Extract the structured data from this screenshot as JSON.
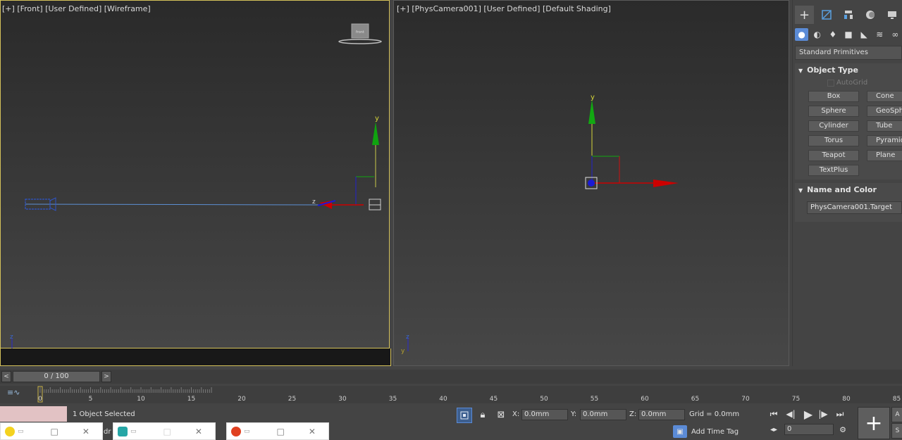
{
  "viewports": {
    "left": {
      "label_plus": "[+]",
      "label_view": "[Front]",
      "label_custom": "[User Defined]",
      "label_shading": "[Wireframe]"
    },
    "right": {
      "label_plus": "[+]",
      "label_view": "[PhysCamera001]",
      "label_custom": "[User Defined]",
      "label_shading": "[Default Shading]"
    },
    "viewcube_label": "front",
    "axis_y": "y",
    "axis_z": "z",
    "axis_x": "x"
  },
  "command_panel": {
    "tabs": [
      "+",
      "modify",
      "hierarchy",
      "motion",
      "display",
      "utilities"
    ],
    "categories": [
      "geometry",
      "shapes",
      "lights",
      "cameras",
      "helpers",
      "spacewarps",
      "systems"
    ],
    "dropdown": "Standard Primitives",
    "object_type": {
      "title": "Object Type",
      "autogrid": "AutoGrid",
      "buttons": [
        "Box",
        "Cone",
        "Sphere",
        "GeoSphere",
        "Cylinder",
        "Tube",
        "Torus",
        "Pyramid",
        "Teapot",
        "Plane",
        "TextPlus"
      ]
    },
    "name_color": {
      "title": "Name and Color",
      "name_value": "PhysCamera001.Target"
    }
  },
  "time_slider": {
    "value": "0 / 100",
    "prev": "<",
    "next": ">"
  },
  "track_ticks": [
    "0",
    "5",
    "10",
    "15",
    "20",
    "25",
    "30",
    "35",
    "40",
    "45",
    "50",
    "55",
    "60",
    "65",
    "70",
    "75",
    "80",
    "85"
  ],
  "status": {
    "selection": "1 Object Selected",
    "x_label": "X:",
    "x_value": "0.0mm",
    "y_label": "Y:",
    "y_value": "0.0mm",
    "z_label": "Z:",
    "z_value": "0.0mm",
    "grid": "Grid = 0.0mm",
    "add_time_tag": "Add Time Tag",
    "frame_value": "0",
    "partial_text": "dr",
    "s_label": "S"
  },
  "colors": {
    "active_border": "#d4c15a",
    "axis_red": "#cc0000",
    "axis_green": "#00aa00",
    "axis_blue": "#1a1ad6",
    "selection_blue": "#5b8bd6"
  }
}
